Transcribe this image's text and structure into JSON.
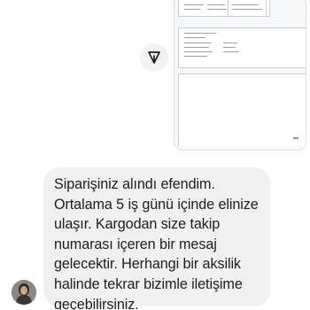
{
  "conversation": {
    "attachment": {
      "kind": "image"
    },
    "share_button": {
      "icon": "share-forward-icon"
    },
    "incoming_message": {
      "text": "Siparişiniz alındı efendim.\nOrtalama 5 iş günü içinde elinize ulaşır. Kargodan size takip numarası içeren bir mesaj gelecektir. Herhangi bir aksilik halinde tekrar bizimle iletişime geçebilirsiniz.",
      "lines": [
        "Siparişiniz alındı efendim.",
        "Ortalama 5 iş günü içinde elinize",
        "ulaşır. Kargodan size takip",
        "numarası içeren bir mesaj",
        "gelecektir. Herhangi bir aksilik",
        "halinde tekrar bizimle iletişime",
        "geçebilirsiniz."
      ]
    },
    "sender": {
      "avatar_icon": "person-avatar-icon"
    }
  },
  "colors": {
    "background": "#ffffff",
    "bubble": "#f0f0f0",
    "text": "#1c1e21",
    "share_button": "#f0f2f5"
  }
}
